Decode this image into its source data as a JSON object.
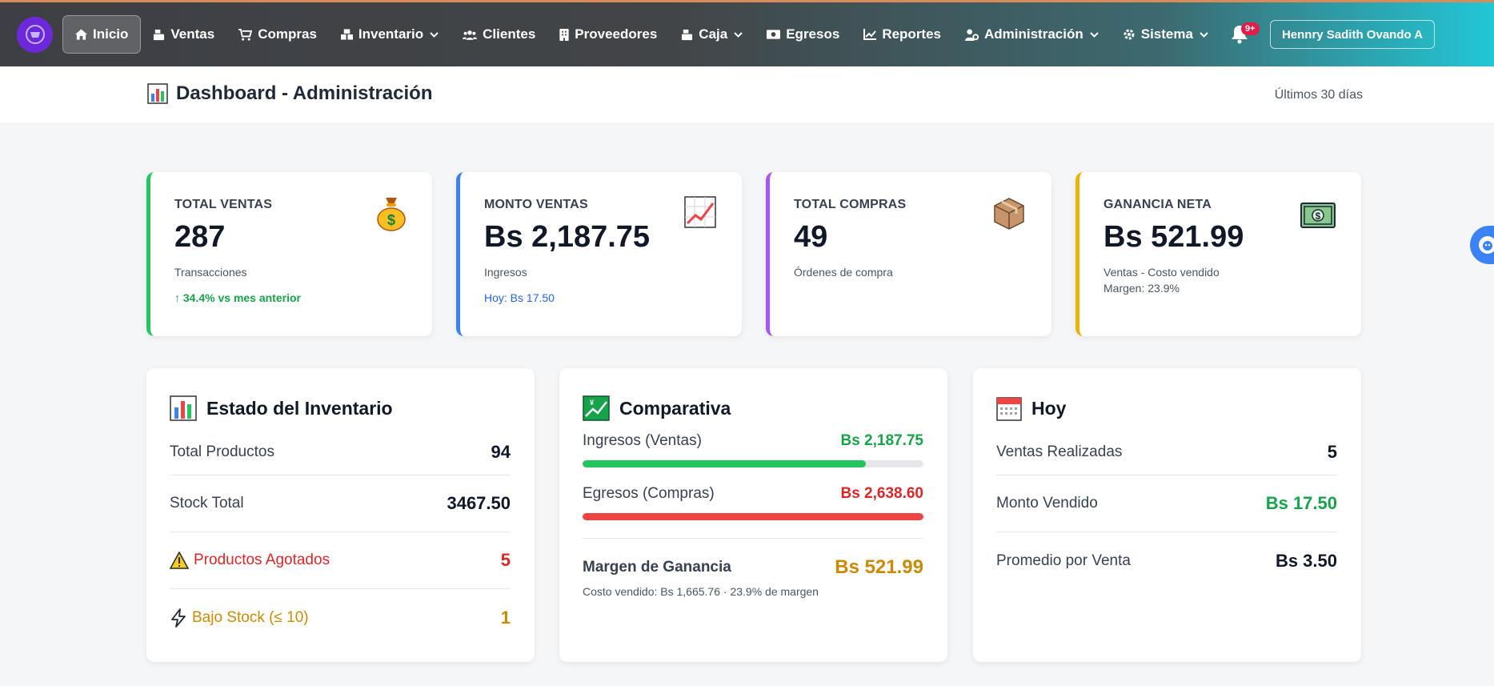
{
  "nav": {
    "items": [
      {
        "label": "Inicio",
        "icon": "home-icon"
      },
      {
        "label": "Ventas",
        "icon": "cash-register-icon"
      },
      {
        "label": "Compras",
        "icon": "cart-icon"
      },
      {
        "label": "Inventario",
        "icon": "boxes-icon"
      },
      {
        "label": "Clientes",
        "icon": "users-icon"
      },
      {
        "label": "Proveedores",
        "icon": "building-icon"
      },
      {
        "label": "Caja",
        "icon": "cash-register-icon"
      },
      {
        "label": "Egresos",
        "icon": "money-bill-icon"
      },
      {
        "label": "Reportes",
        "icon": "chart-line-icon"
      },
      {
        "label": "Administración",
        "icon": "user-gear-icon"
      },
      {
        "label": "Sistema",
        "icon": "gear-icon"
      }
    ],
    "notifications_badge": "9+",
    "user_name": "Hennry Sadith Ovando A"
  },
  "header": {
    "title": "Dashboard - Administración",
    "range": "Últimos 30 días"
  },
  "stats": [
    {
      "label": "TOTAL VENTAS",
      "value": "287",
      "sub": "Transacciones",
      "trend": "↑ 34.4% vs mes anterior",
      "accent": "#22c55e",
      "icon": "money-bag-icon"
    },
    {
      "label": "MONTO VENTAS",
      "value": "Bs 2,187.75",
      "sub": "Ingresos",
      "trend": "Hoy: Bs 17.50",
      "accent": "#3b82f6",
      "icon": "chart-increasing-icon"
    },
    {
      "label": "TOTAL COMPRAS",
      "value": "49",
      "sub": "Órdenes de compra",
      "trend": "",
      "accent": "#a855f7",
      "icon": "package-icon"
    },
    {
      "label": "GANANCIA NETA",
      "value": "Bs 521.99",
      "sub": "Ventas - Costo vendido",
      "sub2": "Margen: 23.9%",
      "accent": "#eab308",
      "icon": "dollar-banknote-icon"
    }
  ],
  "inventory": {
    "title": "Estado del Inventario",
    "rows": [
      {
        "label": "Total Productos",
        "value": "94"
      },
      {
        "label": "Stock Total",
        "value": "3467.50"
      },
      {
        "label": "Productos Agotados",
        "value": "5"
      },
      {
        "label": "Bajo Stock (≤ 10)",
        "value": "1"
      }
    ]
  },
  "comparativa": {
    "title": "Comparativa",
    "ingresos_label": "Ingresos (Ventas)",
    "ingresos_value": "Bs 2,187.75",
    "ingresos_fill": 0.83,
    "egresos_label": "Egresos (Compras)",
    "egresos_value": "Bs 2,638.60",
    "egresos_fill": 1.0,
    "margin_label": "Margen de Ganancia",
    "margin_value": "Bs 521.99",
    "margin_sub": "Costo vendido: Bs 1,665.76 · 23.9% de margen"
  },
  "today": {
    "title": "Hoy",
    "rows": [
      {
        "label": "Ventas Realizadas",
        "value": "5"
      },
      {
        "label": "Monto Vendido",
        "value": "Bs 17.50"
      },
      {
        "label": "Promedio por Venta",
        "value": "Bs 3.50"
      }
    ]
  }
}
